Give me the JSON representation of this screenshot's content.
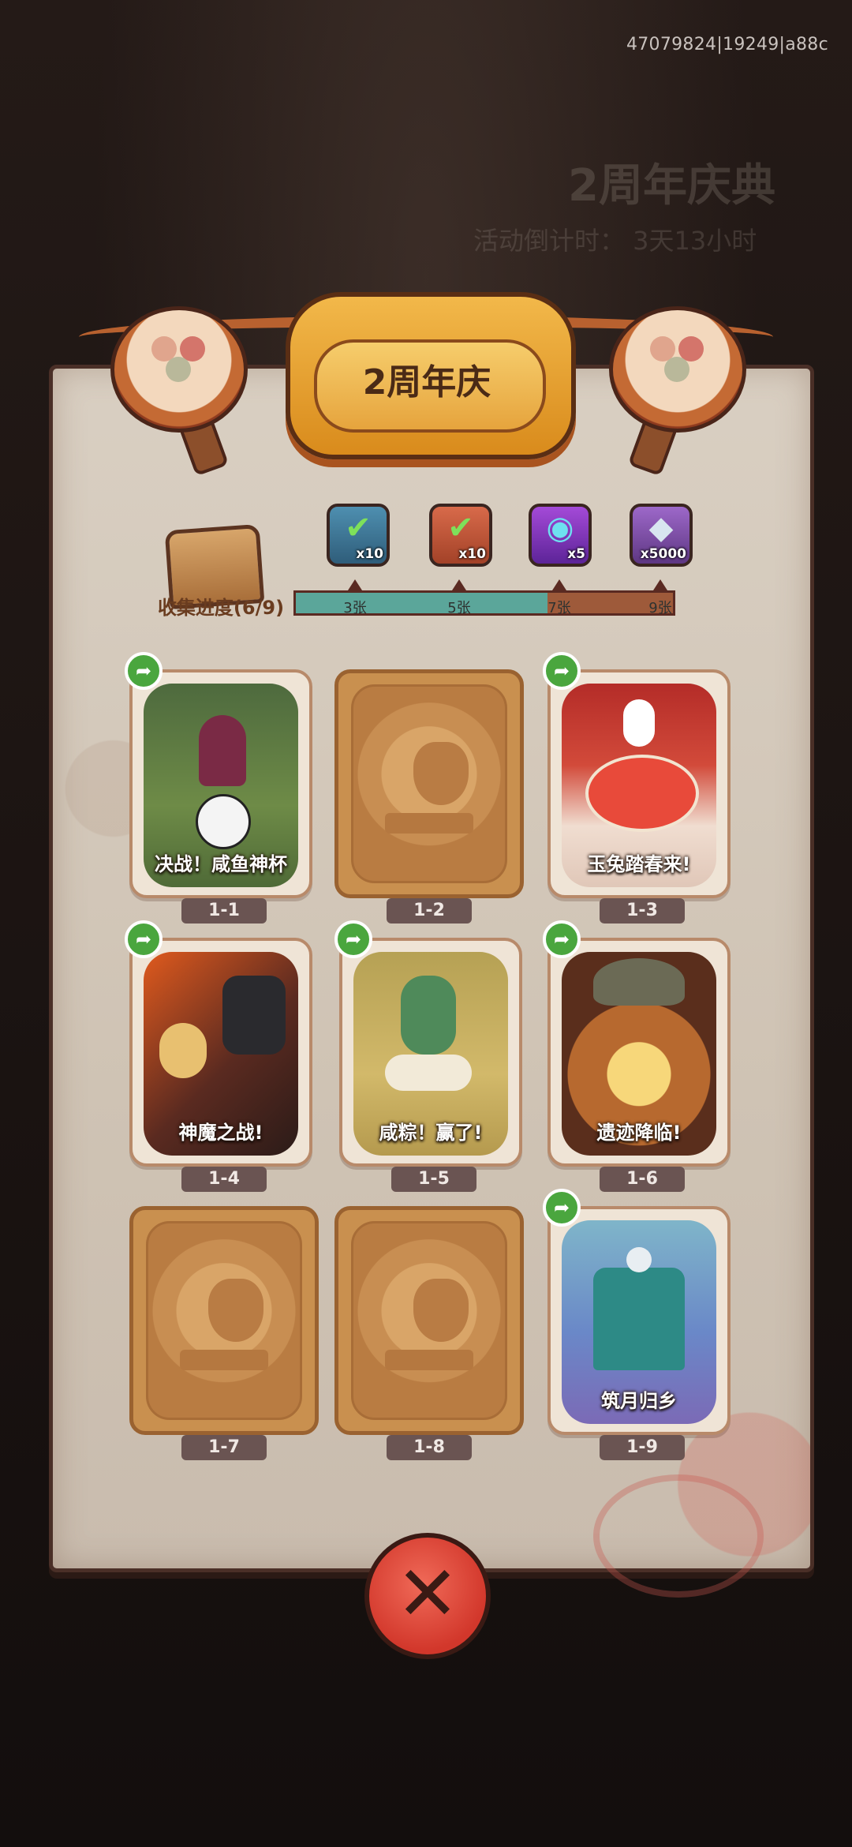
{
  "debug_id": "47079824|19249|a88c",
  "background": {
    "event_title": "2周年庆典",
    "countdown": "活动倒计时： 3天13小时"
  },
  "header": {
    "title": "2周年庆"
  },
  "progress": {
    "label": "收集进度(6/9)",
    "collected": 6,
    "total": 9,
    "rewards": [
      {
        "icon": "treasure-chest-icon",
        "qty": "x10",
        "threshold": "3张",
        "claimed": true
      },
      {
        "icon": "gold-chest-icon",
        "qty": "x10",
        "threshold": "5张",
        "claimed": true
      },
      {
        "icon": "magic-orb-icon",
        "qty": "x5",
        "threshold": "7张",
        "claimed": false
      },
      {
        "icon": "crystal-gem-icon",
        "qty": "x5000",
        "threshold": "9张",
        "claimed": false
      }
    ]
  },
  "cards": [
    {
      "id": "1-1",
      "title": "决战！咸鱼神杯",
      "collected": true
    },
    {
      "id": "1-2",
      "title": "",
      "collected": false
    },
    {
      "id": "1-3",
      "title": "玉兔踏春来!",
      "collected": true
    },
    {
      "id": "1-4",
      "title": "神魔之战!",
      "collected": true
    },
    {
      "id": "1-5",
      "title": "咸粽！赢了!",
      "collected": true
    },
    {
      "id": "1-6",
      "title": "遗迹降临!",
      "collected": true
    },
    {
      "id": "1-7",
      "title": "",
      "collected": false
    },
    {
      "id": "1-8",
      "title": "",
      "collected": false
    },
    {
      "id": "1-9",
      "title": "筑月归乡",
      "collected": true
    }
  ],
  "colors": {
    "bar_filled": "#5ba69a",
    "bar_empty": "#9e5a3a",
    "share_badge": "#4aa63e",
    "close_button": "#d2372b"
  }
}
